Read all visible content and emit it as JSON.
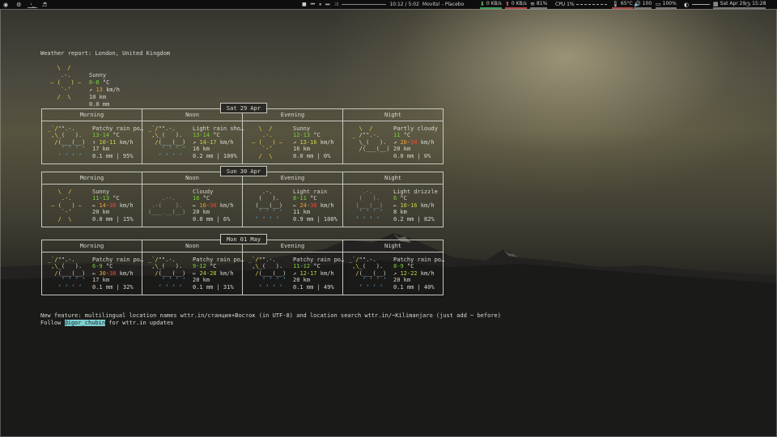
{
  "topbar": {
    "workspaces": [
      {
        "icon": "app-launcher-icon"
      },
      {
        "icon": "settings-icon"
      },
      {
        "label": "›_"
      },
      {
        "icon": "music-note-icon"
      }
    ],
    "media": {
      "controls": [
        "■",
        "⏮",
        "⏸",
        "⏭",
        "⤨"
      ],
      "time": "10:12 / 5:02",
      "track": "Movits! - Placebo"
    },
    "download": "0 KB/s",
    "upload": "0 KB/s",
    "wifi": "81%",
    "cpu": "CPU 1%",
    "temp": "65°C",
    "volume": "100",
    "battery": "100%",
    "date": "Sat Apr 29",
    "time": "15:28"
  },
  "report": {
    "title": "Weather report: London, United Kingdom",
    "current": {
      "art": [
        {
          "t": "   \\  /      ",
          "c": "y"
        },
        {
          "t": "    .-.      ",
          "c": "y"
        },
        {
          "t": " ― (   ) ―   ",
          "c": "y"
        },
        {
          "t": "    `-’      ",
          "c": "y"
        },
        {
          "t": "   /  \\      ",
          "c": "y"
        }
      ],
      "condition": "Sunny",
      "temp": "6-8",
      "temp_unit": " °C",
      "wind_arrow": "↗",
      "wind": "13",
      "wind_unit": " km/h",
      "visibility": "10 km",
      "precip": "0.0 mm"
    },
    "periods": [
      "Morning",
      "Noon",
      "Evening",
      "Night"
    ],
    "days": [
      {
        "date": "Sat 29 Apr",
        "cells": [
          {
            "art": [
              {
                "t": "_`/\"\".-.   ",
                "c": "yw"
              },
              {
                "t": " ,\\_(   ).  ",
                "c": "yw"
              },
              {
                "t": "  /(___(__) ",
                "c": "yw"
              },
              {
                "t": "    ‘ ‘ ‘ ‘ ",
                "c": "b"
              },
              {
                "t": "   ‘ ‘ ‘ ‘  ",
                "c": "b"
              }
            ],
            "condition": "Patchy rain po…",
            "temp": "13-14",
            "wind_arrow": "↑",
            "wind": "10-11",
            "wind_hi": "",
            "visibility": "17 km",
            "precip": "0.1 mm | 95%"
          },
          {
            "art": [
              {
                "t": "_`/\"\".-.   ",
                "c": "yw"
              },
              {
                "t": " ,\\_(   ).  ",
                "c": "yw"
              },
              {
                "t": "  /(___(__) ",
                "c": "yw"
              },
              {
                "t": "    ‘ ‘ ‘ ‘ ",
                "c": "b"
              },
              {
                "t": "   ‘ ‘ ‘ ‘  ",
                "c": "b"
              }
            ],
            "condition": "Light rain sho…",
            "temp": "13-14",
            "wind_arrow": "↗",
            "wind": "14-17",
            "wind_hi": "",
            "visibility": "16 km",
            "precip": "0.2 mm | 100%"
          },
          {
            "art": [
              {
                "t": "   \\  /    ",
                "c": "y"
              },
              {
                "t": "    .-.    ",
                "c": "y"
              },
              {
                "t": " ― (   ) ― ",
                "c": "y"
              },
              {
                "t": "    `-’    ",
                "c": "y"
              },
              {
                "t": "   /  \\    ",
                "c": "y"
              }
            ],
            "condition": "Sunny",
            "temp": "12-13",
            "wind_arrow": "↗",
            "wind": "13-16",
            "wind_hi": "",
            "visibility": "16 km",
            "precip": "0.0 mm | 0%"
          },
          {
            "art": [
              {
                "t": "   \\  /     ",
                "c": "y"
              },
              {
                "t": " _ /\"\".-.   ",
                "c": "yw"
              },
              {
                "t": "   \\_(   ). ",
                "c": "yw"
              },
              {
                "t": "   /(___(__)",
                "c": "yw"
              },
              {
                "t": "            ",
                "c": "w"
              }
            ],
            "condition": "Partly cloudy",
            "temp": "11",
            "wind_arrow": "↗",
            "wind": "20-",
            "wind_hi": "30",
            "visibility": "20 km",
            "precip": "0.0 mm | 0%"
          }
        ]
      },
      {
        "date": "Sun 30 Apr",
        "cells": [
          {
            "art": [
              {
                "t": "   \\  /    ",
                "c": "y"
              },
              {
                "t": "    .-.    ",
                "c": "y"
              },
              {
                "t": " ― (   ) ― ",
                "c": "y"
              },
              {
                "t": "    `-’    ",
                "c": "y"
              },
              {
                "t": "   /  \\    ",
                "c": "y"
              }
            ],
            "condition": "Sunny",
            "temp": "11-13",
            "wind_arrow": "←",
            "wind": "14-",
            "wind_hi": "30",
            "visibility": "20 km",
            "precip": "0.0 mm | 15%"
          },
          {
            "art": [
              {
                "t": "           ",
                "c": "w"
              },
              {
                "t": "    .--.   ",
                "c": "dim"
              },
              {
                "t": " .-(    ). ",
                "c": "dim"
              },
              {
                "t": "(___.__)__)",
                "c": "dim"
              },
              {
                "t": "           ",
                "c": "w"
              }
            ],
            "condition": "Cloudy",
            "temp": "16",
            "wind_arrow": "←",
            "wind": "16-",
            "wind_hi": "30",
            "visibility": "20 km",
            "precip": "0.0 mm | 6%"
          },
          {
            "art": [
              {
                "t": "    .-.    ",
                "c": "w"
              },
              {
                "t": "   (   ).  ",
                "c": "w"
              },
              {
                "t": "  (___(__) ",
                "c": "w"
              },
              {
                "t": "   ‘ ‘ ‘ ‘ ",
                "c": "b"
              },
              {
                "t": "  ‘ ‘ ‘ ‘  ",
                "c": "b"
              }
            ],
            "condition": "Light rain",
            "temp": "8-11",
            "wind_arrow": "←",
            "wind": "24-",
            "wind_hi": "30",
            "visibility": "11 km",
            "precip": "0.9 mm | 100%"
          },
          {
            "art": [
              {
                "t": "    .-.    ",
                "c": "dim"
              },
              {
                "t": "   (   ).  ",
                "c": "dim"
              },
              {
                "t": "  (___(__) ",
                "c": "dim"
              },
              {
                "t": "   ‘ ‘ ‘ ‘ ",
                "c": "b"
              },
              {
                "t": "  ‘ ‘ ‘ ‘  ",
                "c": "b"
              }
            ],
            "condition": "Light drizzle",
            "temp": "6",
            "wind_arrow": "←",
            "wind": "10-16",
            "wind_hi": "",
            "visibility": "8 km",
            "precip": "0.2 mm | 82%"
          }
        ]
      },
      {
        "date": "Mon 01 May",
        "cells": [
          {
            "art": [
              {
                "t": "_`/\"\".-.   ",
                "c": "yw"
              },
              {
                "t": " ,\\_(   ).  ",
                "c": "yw"
              },
              {
                "t": "  /(___(__) ",
                "c": "yw"
              },
              {
                "t": "    ‘ ‘ ‘ ‘ ",
                "c": "b"
              },
              {
                "t": "   ‘ ‘ ‘ ‘  ",
                "c": "b"
              }
            ],
            "condition": "Patchy rain po…",
            "temp": "6-9",
            "wind_arrow": "←",
            "wind": "30-",
            "wind_hi": "38",
            "visibility": "17 km",
            "precip": "0.1 mm | 32%"
          },
          {
            "art": [
              {
                "t": "_`/\"\".-.   ",
                "c": "yw"
              },
              {
                "t": " ,\\_(   ).  ",
                "c": "yw"
              },
              {
                "t": "  /(___(__) ",
                "c": "yw"
              },
              {
                "t": "    ‘ ‘ ‘ ‘ ",
                "c": "b"
              },
              {
                "t": "   ‘ ‘ ‘ ‘  ",
                "c": "b"
              }
            ],
            "condition": "Patchy rain po…",
            "temp": "9-12",
            "wind_arrow": "←",
            "wind": "24-28",
            "wind_hi": "",
            "visibility": "20 km",
            "precip": "0.1 mm | 31%"
          },
          {
            "art": [
              {
                "t": "_`/\"\".-.   ",
                "c": "yw"
              },
              {
                "t": " ,\\_(   ).  ",
                "c": "yw"
              },
              {
                "t": "  /(___(__) ",
                "c": "yw"
              },
              {
                "t": "    ‘ ‘ ‘ ‘ ",
                "c": "b"
              },
              {
                "t": "   ‘ ‘ ‘ ‘  ",
                "c": "b"
              }
            ],
            "condition": "Patchy rain po…",
            "temp": "11-12",
            "wind_arrow": "↗",
            "wind": "12-17",
            "wind_hi": "",
            "visibility": "20 km",
            "precip": "0.1 mm | 49%"
          },
          {
            "art": [
              {
                "t": "_`/\"\".-.   ",
                "c": "yw"
              },
              {
                "t": " ,\\_(   ).  ",
                "c": "yw"
              },
              {
                "t": "  /(___(__) ",
                "c": "yw"
              },
              {
                "t": "    ‘ ‘ ‘ ‘ ",
                "c": "b"
              },
              {
                "t": "   ‘ ‘ ‘ ‘  ",
                "c": "b"
              }
            ],
            "condition": "Patchy rain po…",
            "temp": "8-9",
            "wind_arrow": "↗",
            "wind": "12-22",
            "wind_hi": "",
            "visibility": "20 km",
            "precip": "0.1 mm | 40%"
          }
        ]
      }
    ],
    "footer": {
      "line1_pre": "New feature: multilingual location names ",
      "line1_url1": "wttr.in/станция+Восток",
      "line1_mid": " (in UTF-8) and location search ",
      "line1_url2": "wttr.in/~Kilimanjaro",
      "line1_post": " (just add ~ before)",
      "line2_pre": "Follow ",
      "line2_handle": "@igor_chubin",
      "line2_post": " for wttr.in updates"
    }
  },
  "colors": {
    "sun": "#f1d34a",
    "temp_green": "#7bd23a",
    "wind_red": "#f04838",
    "rain_blue": "#5ab8ee",
    "link_highlight": "#7fd0d0"
  }
}
